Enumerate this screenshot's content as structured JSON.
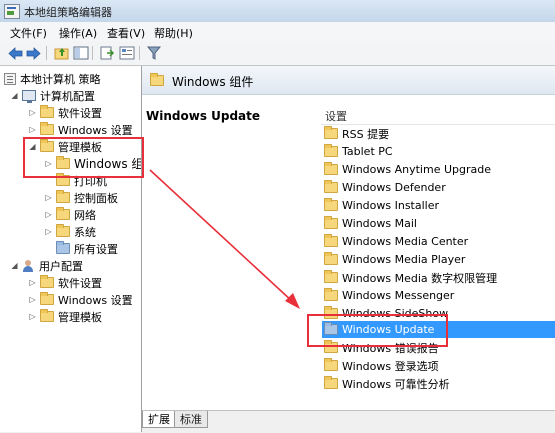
{
  "window": {
    "title": "本地组策略编辑器"
  },
  "menu": [
    "文件(F)",
    "操作(A)",
    "查看(V)",
    "帮助(H)"
  ],
  "toolbar": [
    "back-icon",
    "forward-icon",
    "up-folder-icon",
    "show-hide-tree-icon",
    "export-list-icon",
    "properties-icon",
    "filter-icon"
  ],
  "tree": {
    "root": "本地计算机 策略",
    "computer_config": "计算机配置",
    "software_settings": "软件设置",
    "windows_settings": "Windows 设置",
    "admin_templates": "管理模板",
    "windows_components": "Windows 组件",
    "printers": "打印机",
    "control_panel": "控制面板",
    "network": "网络",
    "system": "系统",
    "all_settings": "所有设置",
    "user_config": "用户配置",
    "user_software_settings": "软件设置",
    "user_windows_settings": "Windows 设置",
    "user_admin_templates": "管理模板"
  },
  "right_pane": {
    "header": "Windows 组件",
    "description_title": "Windows Update",
    "column_header": "设置",
    "items": [
      "RSS 提要",
      "Tablet PC",
      "Windows Anytime Upgrade",
      "Windows Defender",
      "Windows Installer",
      "Windows Mail",
      "Windows Media Center",
      "Windows Media Player",
      "Windows Media 数字权限管理",
      "Windows Messenger",
      "Windows SideShow",
      "Windows Update",
      "Windows 错误报告",
      "Windows 登录选项",
      "Windows 可靠性分析"
    ],
    "selected_item": "Windows Update"
  },
  "tabs": [
    "扩展",
    "标准"
  ],
  "colors": {
    "selection": "#3399ff",
    "annotation": "#e8303a"
  }
}
